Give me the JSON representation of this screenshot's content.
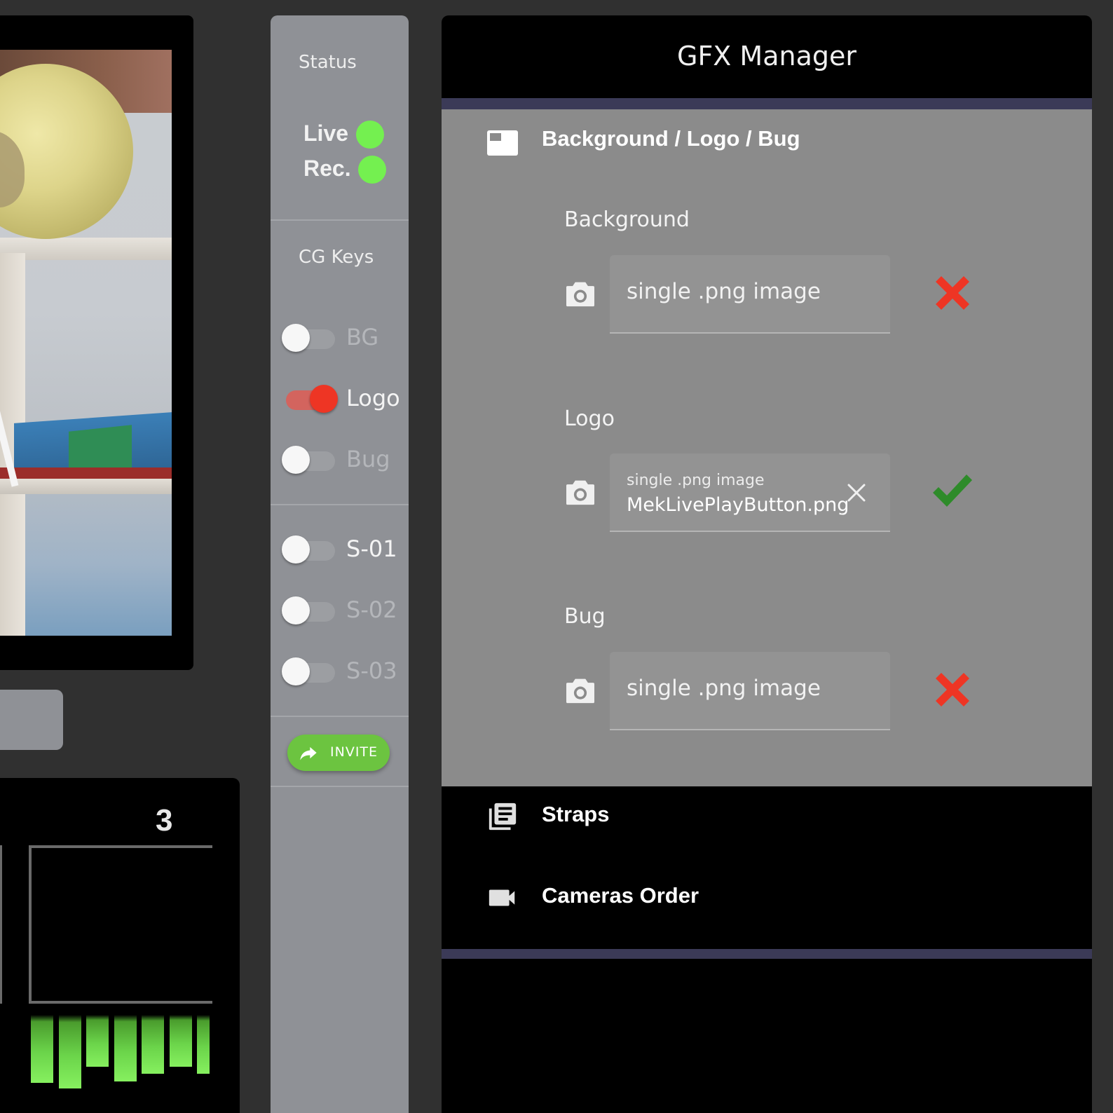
{
  "camera_tile": {
    "number": "3",
    "audio_levels": [
      0.72,
      0.78,
      0.55,
      0.7,
      0.62,
      0.55,
      0.62
    ]
  },
  "status_panel": {
    "status_label": "Status",
    "indicators": [
      {
        "label": "Live",
        "state": "on",
        "color": "#74f050"
      },
      {
        "label": "Rec.",
        "state": "on",
        "color": "#74f050"
      }
    ],
    "cg_keys_label": "CG Keys",
    "keys": [
      {
        "label": "BG",
        "on": false
      },
      {
        "label": "Logo",
        "on": true
      },
      {
        "label": "Bug",
        "on": false
      }
    ],
    "straps": [
      {
        "label": "S-01",
        "on": false
      },
      {
        "label": "S-02",
        "on": false
      },
      {
        "label": "S-03",
        "on": false
      }
    ],
    "invite_label": "INVITE",
    "invite_icon": "share-arrow-icon"
  },
  "gfx_manager": {
    "title": "GFX Manager",
    "section": {
      "title": "Background / Logo / Bug",
      "icon": "window-icon",
      "fields": [
        {
          "label": "Background",
          "placeholder": "single .png image",
          "value": "",
          "status": "missing"
        },
        {
          "label": "Logo",
          "placeholder": "single .png image",
          "value": "MekLivePlayButton.png",
          "status": "ok"
        },
        {
          "label": "Bug",
          "placeholder": "single .png image",
          "value": "",
          "status": "missing"
        }
      ]
    },
    "menu": [
      {
        "label": "Straps",
        "icon": "article-list-icon"
      },
      {
        "label": "Cameras Order",
        "icon": "videocam-icon"
      }
    ],
    "colors": {
      "accent_stripe": "#3b3a57",
      "missing": "#ee3524",
      "ok": "#2e8b2a"
    }
  }
}
